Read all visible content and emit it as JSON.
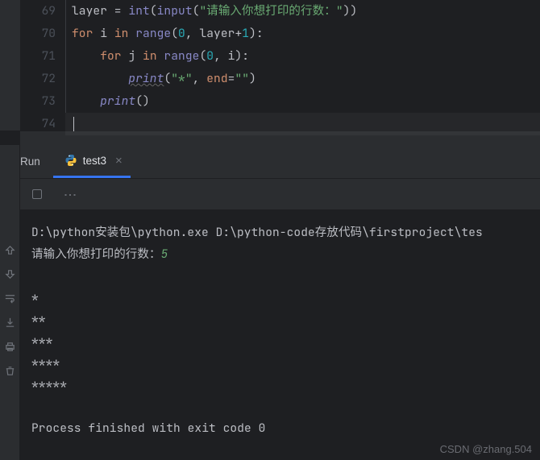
{
  "editor": {
    "line_numbers": [
      "69",
      "70",
      "71",
      "72",
      "73",
      "74"
    ],
    "tokens": {
      "l69": {
        "layer": "layer",
        "eq": " = ",
        "int": "int",
        "lp": "(",
        "input": "input",
        "lp2": "(",
        "str": "\"请输入你想打印的行数：\"",
        "rp": "))"
      },
      "l70": {
        "for": "for",
        "i": " i ",
        "in": "in",
        "range": " range",
        "lp": "(",
        "zero": "0",
        "comma": ", layer+",
        "one": "1",
        "rp": "):"
      },
      "l71": {
        "indent": "    ",
        "for": "for",
        "j": " j ",
        "in": "in",
        "range": " range",
        "lp": "(",
        "zero": "0",
        "comma": ", i):"
      },
      "l72": {
        "indent": "        ",
        "print": "print",
        "lp": "(",
        "star": "\"*\"",
        "comma": ", ",
        "end": "end",
        "eq": "=",
        "empty": "\"\"",
        "rp": ")"
      },
      "l73": {
        "indent": "    ",
        "print": "print",
        "lp": "()"
      }
    }
  },
  "run_panel": {
    "label": "Run",
    "tab_name": "test3"
  },
  "console": {
    "cmd": "D:\\python安装包\\python.exe D:\\python-code存放代码\\firstproject\\tes",
    "prompt": "请输入你想打印的行数：",
    "input_value": "5",
    "out1": "*",
    "out2": "**",
    "out3": "***",
    "out4": "****",
    "out5": "*****",
    "exit": "Process finished with exit code 0"
  },
  "watermark": "CSDN @zhang.504"
}
